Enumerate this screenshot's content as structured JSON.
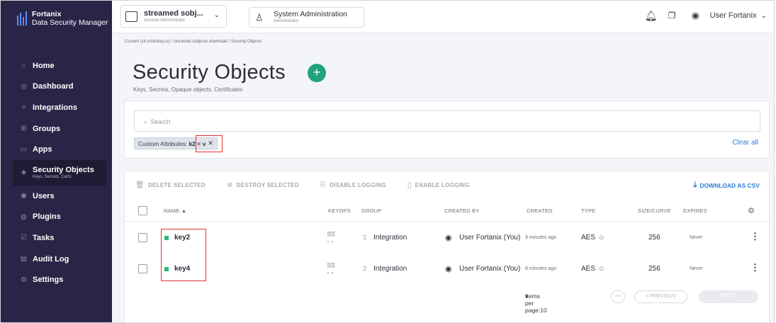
{
  "brand": {
    "name": "Fortanix",
    "product": "Data Security Manager"
  },
  "sidebar": {
    "items": [
      {
        "label": "Home",
        "icon": "home-icon",
        "glyph": "⌂"
      },
      {
        "label": "Dashboard",
        "icon": "dashboard-icon",
        "glyph": "◎"
      },
      {
        "label": "Integrations",
        "icon": "integrations-icon",
        "glyph": "⟡"
      },
      {
        "label": "Groups",
        "icon": "groups-icon",
        "glyph": "⊞"
      },
      {
        "label": "Apps",
        "icon": "apps-icon",
        "glyph": "▭"
      },
      {
        "label": "Security Objects",
        "sub": "Keys, Secrets, Certs",
        "icon": "security-objects-icon",
        "glyph": "◈",
        "active": true
      },
      {
        "label": "Users",
        "icon": "users-icon",
        "glyph": "◉"
      },
      {
        "label": "Plugins",
        "icon": "plugins-icon",
        "glyph": "◍"
      },
      {
        "label": "Tasks",
        "icon": "tasks-icon",
        "glyph": "☑"
      },
      {
        "label": "Audit Log",
        "icon": "audit-log-icon",
        "glyph": "▤"
      },
      {
        "label": "Settings",
        "icon": "settings-icon",
        "glyph": "⚙"
      }
    ]
  },
  "topbar": {
    "account": {
      "name": "streamed sobj...",
      "role": "Account Administrator"
    },
    "sysadmin": {
      "name": "System Administration",
      "role": "Administrator"
    },
    "user": "User Fortanix"
  },
  "breadcrumb": "Current (sit.smartkey.io) / streamed sobjects download / Security Objects",
  "page": {
    "title": "Security Objects",
    "subtitle": "Keys, Secrets, Opaque objects, Certificates",
    "add_glyph": "+"
  },
  "search": {
    "placeholder": "Search",
    "filter_label": "Custom Attributes:",
    "filter_value": "k2 = v",
    "clear_all": "Clear all"
  },
  "toolbar": {
    "delete": "DELETE SELECTED",
    "destroy": "DESTROY SELECTED",
    "disable_logging": "DISABLE LOGGING",
    "enable_logging": "ENABLE LOGGING",
    "download_csv": "DOWNLOAD AS CSV"
  },
  "table": {
    "headers": {
      "name": "NAME ▲",
      "keyops": "KEYOPS",
      "group": "GROUP",
      "created_by": "CREATED BY",
      "created": "CREATED",
      "type": "TYPE",
      "size": "SIZE/CURVE",
      "expires": "EXPIRES"
    },
    "rows": [
      {
        "name": "key2",
        "group": "Integration",
        "created_by": "User Fortanix (You)",
        "created": "9 minutes ago",
        "type": "AES",
        "size": "256",
        "expires": "Never"
      },
      {
        "name": "key4",
        "group": "Integration",
        "created_by": "User Fortanix (You)",
        "created": "8 minutes ago",
        "type": "AES",
        "size": "256",
        "expires": "Never"
      }
    ]
  },
  "pagination": {
    "items_per_page": "Items per page:10",
    "first": "<<",
    "previous": "< PREVIOUS",
    "next": "NEXT >"
  },
  "colors": {
    "sidebar": "#2a2547",
    "accent": "#21a37f",
    "link": "#2c7fd6",
    "highlight": "#e0312f",
    "key_status": "#2bb873"
  }
}
